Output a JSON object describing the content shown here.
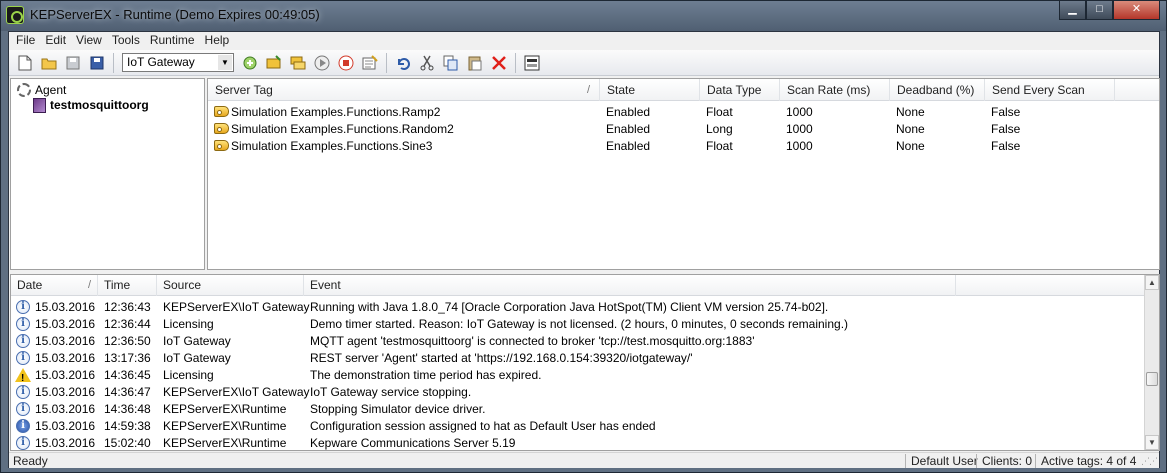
{
  "window": {
    "title": "KEPServerEX - Runtime (Demo Expires 00:49:05)",
    "min_glyph": "▁",
    "max_glyph": "□",
    "close_glyph": "✕"
  },
  "menu": [
    "File",
    "Edit",
    "View",
    "Tools",
    "Runtime",
    "Help"
  ],
  "toolbar": {
    "project_combo_value": "IoT Gateway",
    "dropdown_glyph": "▼"
  },
  "tree": {
    "items": [
      {
        "label": "Agent",
        "icon": "gear-icon",
        "bold": false
      },
      {
        "label": "testmosquittoorg",
        "icon": "mqtt-agent-icon",
        "bold": true
      }
    ]
  },
  "tags": {
    "columns": [
      "Server Tag",
      "State",
      "Data Type",
      "Scan Rate (ms)",
      "Deadband (%)",
      "Send Every Scan"
    ],
    "sort_marker": "/",
    "rows": [
      {
        "tag": "Simulation Examples.Functions.Ramp2",
        "state": "Enabled",
        "type": "Float",
        "rate": "1000",
        "deadband": "None",
        "every": "False"
      },
      {
        "tag": "Simulation Examples.Functions.Random2",
        "state": "Enabled",
        "type": "Long",
        "rate": "1000",
        "deadband": "None",
        "every": "False"
      },
      {
        "tag": "Simulation Examples.Functions.Sine3",
        "state": "Enabled",
        "type": "Float",
        "rate": "1000",
        "deadband": "None",
        "every": "False"
      }
    ]
  },
  "log": {
    "columns": [
      "Date",
      "Time",
      "Source",
      "Event"
    ],
    "sort_marker": "/",
    "rows": [
      {
        "icon": "info",
        "date": "15.03.2016",
        "time": "12:36:43",
        "source": "KEPServerEX\\IoT Gateway",
        "event": "Running with Java 1.8.0_74 [Oracle Corporation Java HotSpot(TM) Client VM version 25.74-b02]."
      },
      {
        "icon": "info",
        "date": "15.03.2016",
        "time": "12:36:44",
        "source": "Licensing",
        "event": "Demo timer started. Reason: IoT Gateway is not licensed. (2 hours, 0 minutes, 0 seconds remaining.)"
      },
      {
        "icon": "info",
        "date": "15.03.2016",
        "time": "12:36:50",
        "source": "IoT Gateway",
        "event": "MQTT agent 'testmosquittoorg' is connected to broker 'tcp://test.mosquitto.org:1883'"
      },
      {
        "icon": "info",
        "date": "15.03.2016",
        "time": "13:17:36",
        "source": "IoT Gateway",
        "event": "REST server 'Agent' started at 'https://192.168.0.154:39320/iotgateway/'"
      },
      {
        "icon": "warning",
        "date": "15.03.2016",
        "time": "14:36:45",
        "source": "Licensing",
        "event": "The demonstration time period has expired."
      },
      {
        "icon": "info",
        "date": "15.03.2016",
        "time": "14:36:47",
        "source": "KEPServerEX\\IoT Gateway",
        "event": "IoT Gateway service stopping."
      },
      {
        "icon": "info",
        "date": "15.03.2016",
        "time": "14:36:48",
        "source": "KEPServerEX\\Runtime",
        "event": "Stopping Simulator device driver."
      },
      {
        "icon": "security",
        "date": "15.03.2016",
        "time": "14:59:38",
        "source": "KEPServerEX\\Runtime",
        "event": "Configuration session assigned to hat as Default User has ended"
      },
      {
        "icon": "info",
        "date": "15.03.2016",
        "time": "15:02:40",
        "source": "KEPServerEX\\Runtime",
        "event": "Kepware Communications Server 5.19"
      }
    ]
  },
  "status": {
    "left": "Ready",
    "user": "Default User",
    "clients": "Clients:  0",
    "active_tags": "Active tags:  4 of 4"
  },
  "colors": {
    "title_bar": "#5f6f82",
    "window_bg": "#f0f0f0",
    "warning": "#f1c21b",
    "info": "#2f5ea8"
  }
}
